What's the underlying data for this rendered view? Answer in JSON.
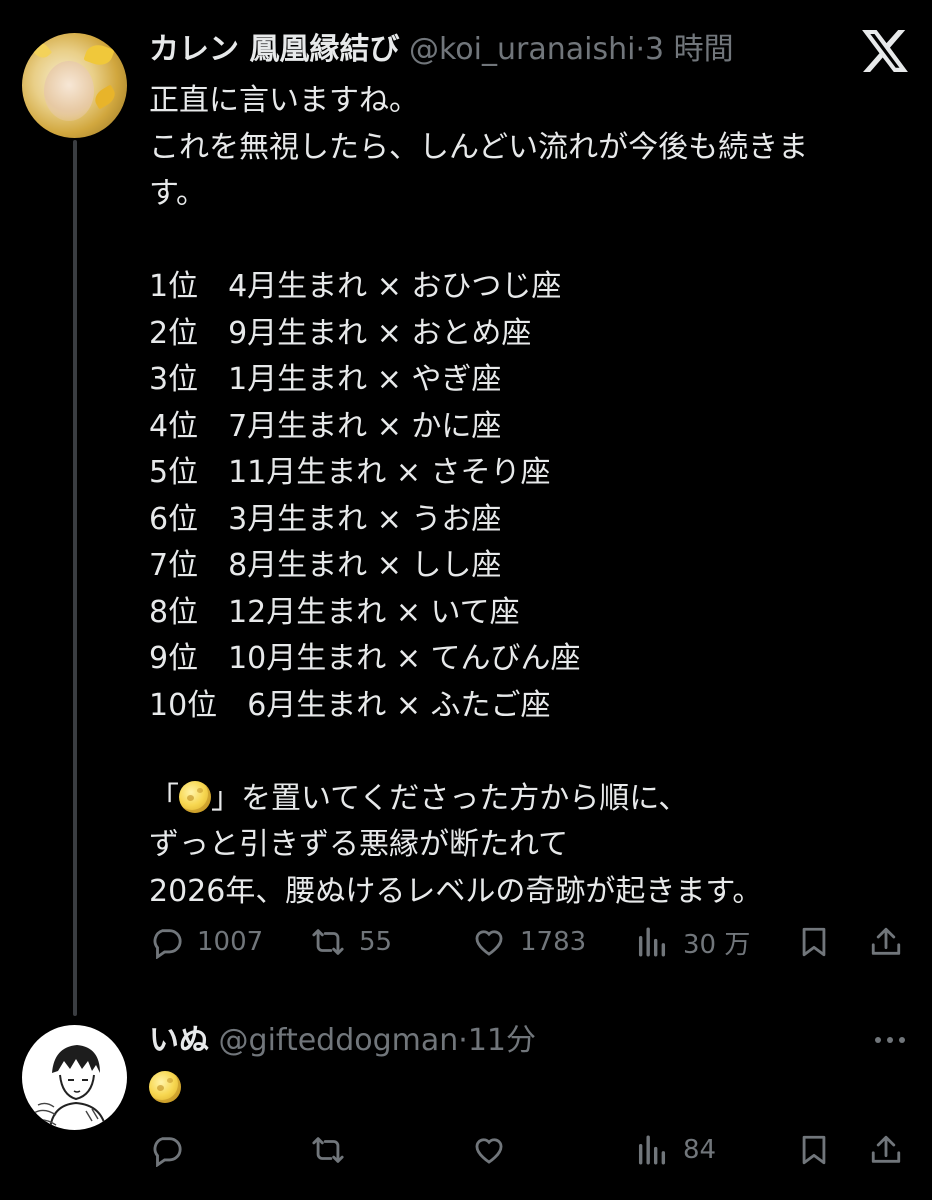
{
  "tweet": {
    "author_name": "カレン 鳳凰縁結び",
    "handle": "@koi_uranaishi",
    "separator": "·",
    "time": "3 時間",
    "intro_lines": [
      "正直に言いますね。",
      "これを無視したら、しんどい流れが今後も続きま",
      "す。"
    ],
    "rankings": [
      {
        "rank": "1位",
        "month": "4月生まれ",
        "sign": "おひつじ座"
      },
      {
        "rank": "2位",
        "month": "9月生まれ",
        "sign": "おとめ座"
      },
      {
        "rank": "3位",
        "month": "1月生まれ",
        "sign": "やぎ座"
      },
      {
        "rank": "4位",
        "month": "7月生まれ",
        "sign": "かに座"
      },
      {
        "rank": "5位",
        "month": "11月生まれ",
        "sign": "さそり座"
      },
      {
        "rank": "6位",
        "month": "3月生まれ",
        "sign": "うお座"
      },
      {
        "rank": "7位",
        "month": "8月生まれ",
        "sign": "しし座"
      },
      {
        "rank": "8位",
        "month": "12月生まれ",
        "sign": "いて座"
      },
      {
        "rank": "9位",
        "month": "10月生まれ",
        "sign": "てんびん座"
      },
      {
        "rank": "10位",
        "month": "6月生まれ",
        "sign": "ふたご座"
      }
    ],
    "times_symbol": "×",
    "closing_open_bracket": "「",
    "closing_after_moon": "」を置いてくださった方から順に、",
    "closing_line2": "ずっと引きずる悪縁が断たれて",
    "closing_line3": "2026年、腰ぬけるレベルの奇跡が起きます。",
    "moon_emoji": "full-moon-emoji",
    "stats": {
      "replies": "1007",
      "reposts": "55",
      "likes": "1783",
      "views": "30 万"
    }
  },
  "reply": {
    "author_name": "いぬ",
    "handle": "@gifteddogman",
    "separator": "·",
    "time": "11分",
    "content_emoji": "full-moon-emoji",
    "stats": {
      "views": "84"
    }
  },
  "icons": {
    "logo": "x-logo-icon",
    "reply": "speech-bubble-icon",
    "repost": "repost-arrows-icon",
    "like": "heart-icon",
    "views": "bar-chart-icon",
    "bookmark": "bookmark-icon",
    "share": "share-upload-icon",
    "more": "more-dots-icon"
  },
  "colors": {
    "background": "#000000",
    "text": "#e7e9ea",
    "secondary": "#71767b",
    "thread_line": "#3a3d41"
  }
}
